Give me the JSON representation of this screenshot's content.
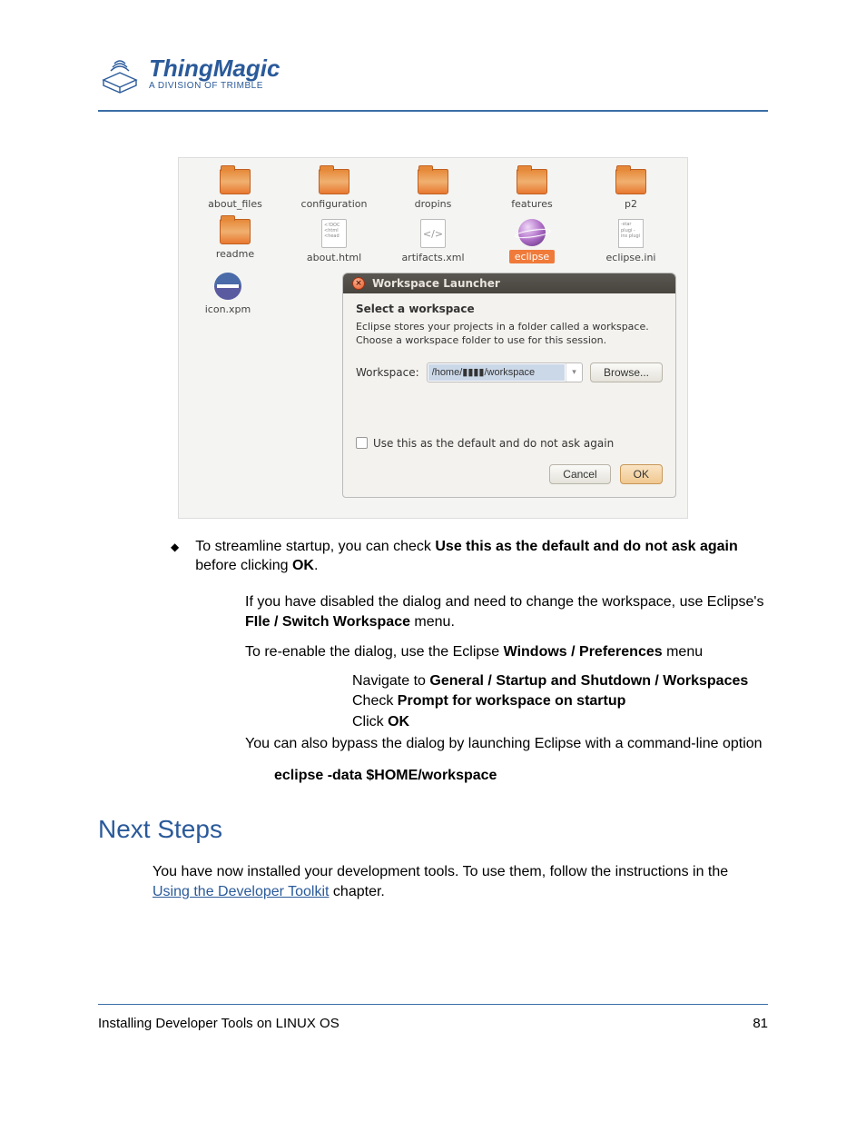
{
  "logo": {
    "main": "ThingMagic",
    "sub": "A DIVISION OF TRIMBLE"
  },
  "shot": {
    "row1": [
      "about_files",
      "configuration",
      "dropins",
      "features",
      "p2"
    ],
    "row2": [
      "readme",
      "about.html",
      "artifacts.xml",
      "eclipse",
      "eclipse.ini"
    ],
    "row3": [
      "icon.xpm"
    ],
    "doc_lines": "<!DOC\n<html\n<head",
    "ini_lines": "-star\nplugi\n-ins\nplugi"
  },
  "dialog": {
    "title": "Workspace Launcher",
    "subtitle": "Select a workspace",
    "desc1": "Eclipse stores your projects in a folder called a workspace.",
    "desc2": "Choose a workspace folder to use for this session.",
    "ws_label": "Workspace:",
    "ws_value": "/home/▮▮▮▮/workspace",
    "browse": "Browse...",
    "check": "Use this as the default and do not ask again",
    "cancel": "Cancel",
    "ok": "OK"
  },
  "bullet": {
    "t1": "To streamline startup, you can check ",
    "b1": "Use this as the default and do not ask again",
    "t2": " before clicking ",
    "b2": "OK",
    "t3": "."
  },
  "p1a": "If you have disabled the dialog and need to change the workspace, use Eclipse's ",
  "p1b": "FIle / Switch Workspace",
  "p1c": " menu.",
  "p2a": "To re-enable the dialog, use the Eclipse ",
  "p2b": "Windows / Preferences",
  "p2c": " menu",
  "nav": {
    "l1a": "Navigate to ",
    "l1b": "General / Startup and Shutdown / Workspaces",
    "l2a": "Check ",
    "l2b": "Prompt for workspace on startup",
    "l3a": "Click ",
    "l3b": "OK"
  },
  "p3": "You can also bypass the dialog by launching Eclipse with a command-line option",
  "cmd": "eclipse -data $HOME/workspace",
  "next_heading": "Next Steps",
  "ns1": "You have now installed your development tools. To use them, follow the instructions in the ",
  "ns_link": "Using the Developer Toolkit",
  "ns2": " chapter.",
  "footer_left": "Installing Developer Tools on LINUX OS",
  "footer_right": "81"
}
